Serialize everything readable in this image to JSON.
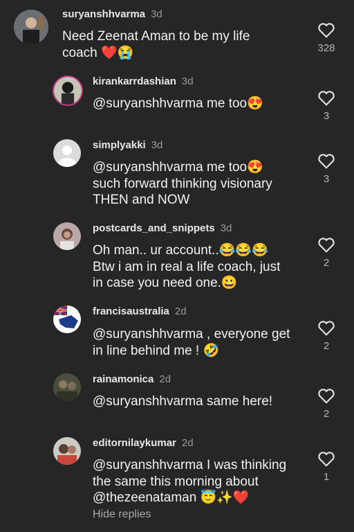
{
  "comments": [
    {
      "username": "suryanshhvarma",
      "time": "3d",
      "text": "Need Zeenat Aman to be my life\ncoach ❤️😭",
      "likes": "328"
    },
    {
      "username": "kirankarrdashian",
      "time": "3d",
      "text": "@suryanshhvarma me too😍",
      "likes": "3"
    },
    {
      "username": "simplyakki",
      "time": "3d",
      "text": "@suryanshhvarma me too😍\nsuch forward thinking visionary\nTHEN and NOW",
      "likes": "3"
    },
    {
      "username": "postcards_and_snippets",
      "time": "3d",
      "text": "Oh man.. ur account..😂😂😂\nBtw i am in real a life coach, just\nin case you need one.😀",
      "likes": "2"
    },
    {
      "username": "francisaustralia",
      "time": "2d",
      "text": "@suryanshhvarma , everyone get\nin line behind me ! 🤣",
      "likes": "2"
    },
    {
      "username": "rainamonica",
      "time": "2d",
      "text": "@suryanshhvarma  same here!",
      "likes": "2"
    },
    {
      "username": "editornilaykumar",
      "time": "2d",
      "text": "@suryanshhvarma I was thinking\nthe same this morning about\n@thezeenataman 😇✨❤️",
      "likes": "1"
    }
  ],
  "hide_replies_label": "Hide replies",
  "icons": {
    "like": "heart-outline-icon"
  },
  "colors": {
    "background": "#262626",
    "text": "#f2f2f2",
    "muted": "#9a9a9a"
  }
}
